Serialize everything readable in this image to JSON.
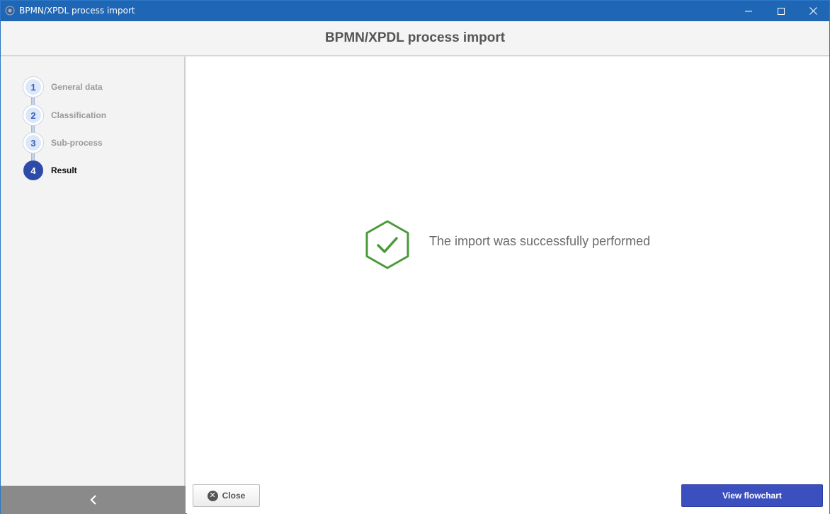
{
  "window": {
    "title": "BPMN/XPDL process import",
    "controls": {
      "minimize": "minimize-icon",
      "maximize": "maximize-icon",
      "close": "close-icon"
    }
  },
  "header": {
    "title": "BPMN/XPDL process import"
  },
  "steps": [
    {
      "number": "1",
      "label": "General data",
      "active": false
    },
    {
      "number": "2",
      "label": "Classification",
      "active": false
    },
    {
      "number": "3",
      "label": "Sub-process",
      "active": false
    },
    {
      "number": "4",
      "label": "Result",
      "active": true
    }
  ],
  "sidebar": {
    "collapse_icon": "chevron-left-icon"
  },
  "result": {
    "message": "The import was successfully performed",
    "icon": "check-hexagon-icon",
    "icon_color": "#4a9a3a"
  },
  "buttons": {
    "close_label": "Close",
    "view_flowchart_label": "View flowchart"
  },
  "colors": {
    "titlebar": "#1f66b5",
    "accent": "#3b4fbf",
    "active_step": "#2e4ba8"
  }
}
